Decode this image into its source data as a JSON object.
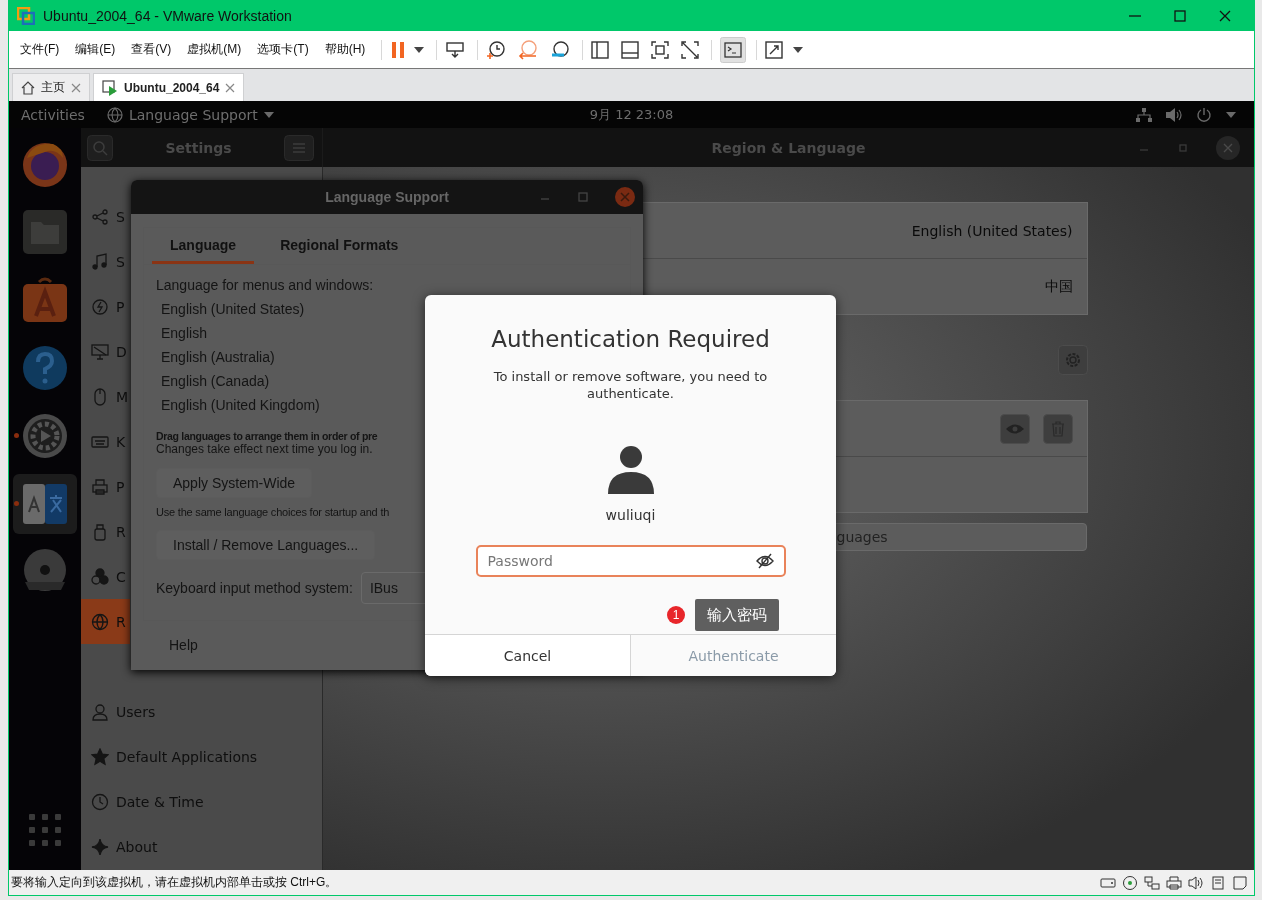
{
  "window": {
    "title": "Ubuntu_2004_64 - VMware Workstation"
  },
  "menu": [
    "文件(F)",
    "编辑(E)",
    "查看(V)",
    "虚拟机(M)",
    "选项卡(T)",
    "帮助(H)"
  ],
  "tabs": [
    {
      "label": "主页",
      "kind": "home",
      "selected": false
    },
    {
      "label": "Ubuntu_2004_64",
      "kind": "vm",
      "selected": true
    }
  ],
  "topbar": {
    "activities": "Activities",
    "app_menu": "Language Support",
    "clock": "9月 12  23:08"
  },
  "dock": [
    {
      "kind": "firefox",
      "running": false,
      "selected": false
    },
    {
      "kind": "files",
      "running": false,
      "selected": false
    },
    {
      "kind": "store",
      "running": false,
      "selected": false
    },
    {
      "kind": "help",
      "running": false,
      "selected": false
    },
    {
      "kind": "gear",
      "running": true,
      "selected": false
    },
    {
      "kind": "language",
      "running": true,
      "selected": true
    },
    {
      "kind": "dvd",
      "running": false,
      "selected": false
    }
  ],
  "settings": {
    "title": "Settings",
    "panel_title": "Region & Language",
    "sidebar": [
      {
        "label": "S",
        "selected": false
      },
      {
        "label": "S",
        "selected": false
      },
      {
        "label": "P",
        "selected": false
      },
      {
        "label": "D",
        "selected": false
      },
      {
        "label": "M",
        "selected": false
      },
      {
        "label": "K",
        "selected": false
      },
      {
        "label": "P",
        "selected": false
      },
      {
        "label": "R",
        "selected": false
      },
      {
        "label": "C",
        "selected": false
      },
      {
        "label": "R",
        "selected": true
      },
      {
        "label": "Users",
        "selected": false
      },
      {
        "label": "Default Applications",
        "selected": false
      },
      {
        "label": "Date & Time",
        "selected": false
      },
      {
        "label": "About",
        "selected": false
      }
    ],
    "rows": [
      {
        "value": "English (United States)"
      },
      {
        "value": "中国"
      }
    ],
    "manage_button": "guages"
  },
  "language_support": {
    "title": "Language Support",
    "tabs": [
      {
        "label": "Language",
        "selected": true
      },
      {
        "label": "Regional Formats",
        "selected": false
      }
    ],
    "heading": "Language for menus and windows:",
    "languages": [
      "English (United States)",
      "English",
      "English (Australia)",
      "English (Canada)",
      "English (United Kingdom)"
    ],
    "drag_hint": "Drag languages to arrange them in order of pre",
    "changes_note": "Changes take effect next time you log in.",
    "apply_button": "Apply System-Wide",
    "startup_note": "Use the same language choices for startup and th",
    "install_button": "Install / Remove Languages...",
    "input_method_label": "Keyboard input method system:",
    "input_method": "IBus",
    "help_button": "Help"
  },
  "auth": {
    "title": "Authentication Required",
    "message": "To install or remove software, you need to authenticate.",
    "user": "wuliuqi",
    "password": {
      "placeholder": "Password"
    },
    "buttons": [
      {
        "label": "Cancel",
        "disabled": false
      },
      {
        "label": "Authenticate",
        "disabled": true
      }
    ]
  },
  "annotation": {
    "number": "1",
    "text": "输入密码"
  },
  "status_bar": "要将输入定向到该虚拟机，请在虚拟机内部单击或按 Ctrl+G。"
}
